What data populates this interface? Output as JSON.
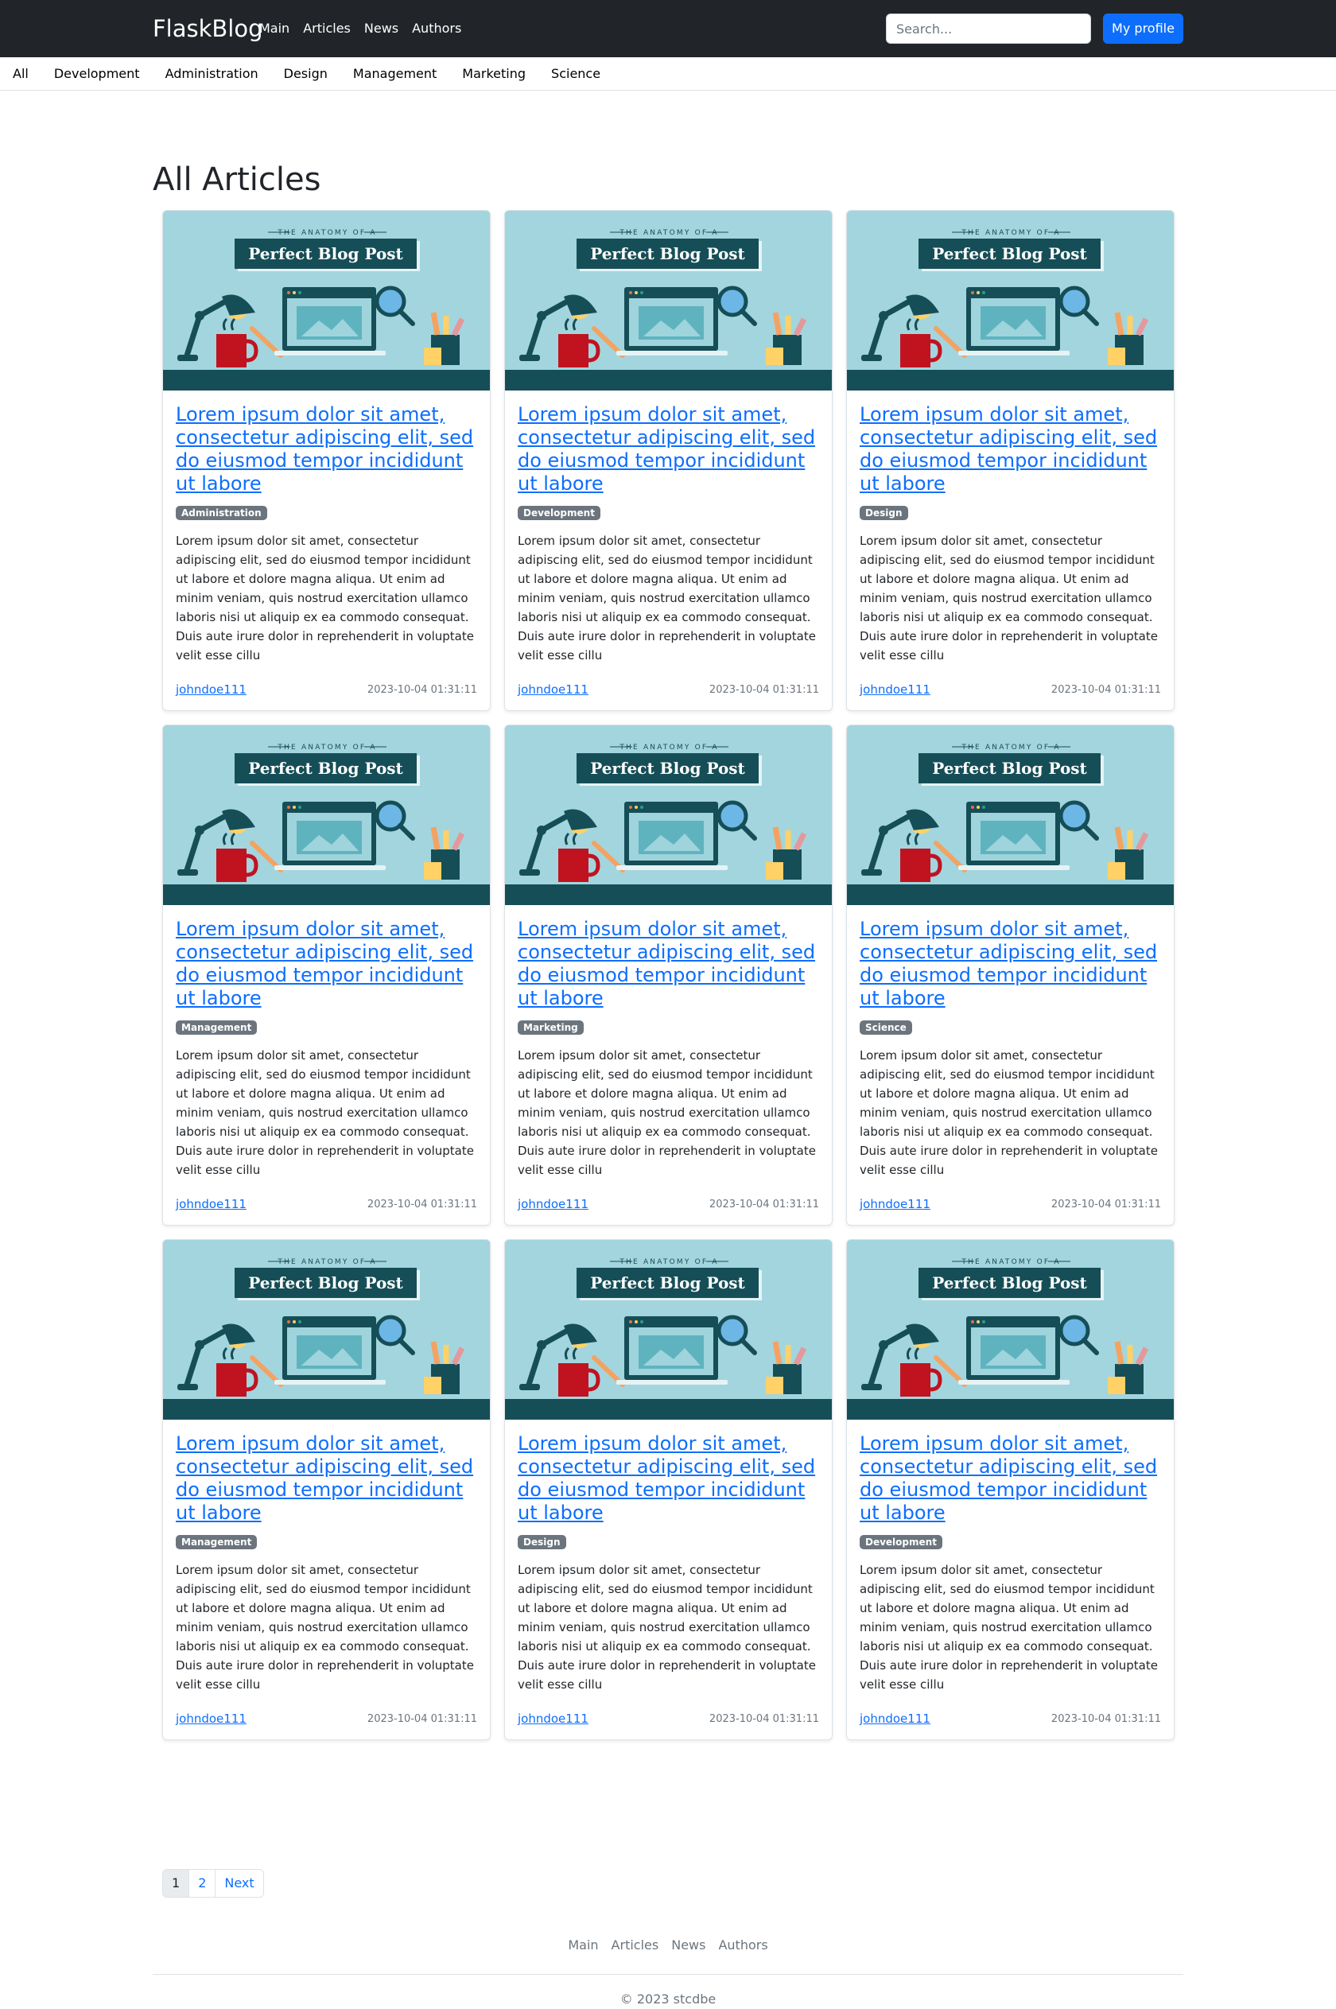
{
  "navbar": {
    "brand": "FlaskBlog",
    "links": [
      "Main",
      "Articles",
      "News",
      "Authors"
    ],
    "search_placeholder": "Search...",
    "profile_button": "My profile"
  },
  "categories": [
    "All",
    "Development",
    "Administration",
    "Design",
    "Management",
    "Marketing",
    "Science"
  ],
  "page_title": "All Articles",
  "image_text": {
    "top": "THE ANATOMY OF A",
    "banner": "Perfect Blog Post"
  },
  "colors": {
    "navbar_bg": "#212529",
    "accent": "#0d6efd",
    "badge": "#6c757d",
    "image_bg": "#a3d5de",
    "image_dark": "#164e57"
  },
  "articles": [
    {
      "title": "Lorem ipsum dolor sit amet, consectetur adipiscing elit, sed do eiusmod tempor incididunt ut labore",
      "category": "Administration",
      "text": "Lorem ipsum dolor sit amet, consectetur adipiscing elit, sed do eiusmod tempor incididunt ut labore et dolore magna aliqua. Ut enim ad minim veniam, quis nostrud exercitation ullamco laboris nisi ut aliquip ex ea commodo consequat. Duis aute irure dolor in reprehenderit in voluptate velit esse cillu",
      "author": "johndoe111",
      "date": "2023-10-04 01:31:11"
    },
    {
      "title": "Lorem ipsum dolor sit amet, consectetur adipiscing elit, sed do eiusmod tempor incididunt ut labore",
      "category": "Development",
      "text": "Lorem ipsum dolor sit amet, consectetur adipiscing elit, sed do eiusmod tempor incididunt ut labore et dolore magna aliqua. Ut enim ad minim veniam, quis nostrud exercitation ullamco laboris nisi ut aliquip ex ea commodo consequat. Duis aute irure dolor in reprehenderit in voluptate velit esse cillu",
      "author": "johndoe111",
      "date": "2023-10-04 01:31:11"
    },
    {
      "title": "Lorem ipsum dolor sit amet, consectetur adipiscing elit, sed do eiusmod tempor incididunt ut labore",
      "category": "Design",
      "text": "Lorem ipsum dolor sit amet, consectetur adipiscing elit, sed do eiusmod tempor incididunt ut labore et dolore magna aliqua. Ut enim ad minim veniam, quis nostrud exercitation ullamco laboris nisi ut aliquip ex ea commodo consequat. Duis aute irure dolor in reprehenderit in voluptate velit esse cillu",
      "author": "johndoe111",
      "date": "2023-10-04 01:31:11"
    },
    {
      "title": "Lorem ipsum dolor sit amet, consectetur adipiscing elit, sed do eiusmod tempor incididunt ut labore",
      "category": "Management",
      "text": "Lorem ipsum dolor sit amet, consectetur adipiscing elit, sed do eiusmod tempor incididunt ut labore et dolore magna aliqua. Ut enim ad minim veniam, quis nostrud exercitation ullamco laboris nisi ut aliquip ex ea commodo consequat. Duis aute irure dolor in reprehenderit in voluptate velit esse cillu",
      "author": "johndoe111",
      "date": "2023-10-04 01:31:11"
    },
    {
      "title": "Lorem ipsum dolor sit amet, consectetur adipiscing elit, sed do eiusmod tempor incididunt ut labore",
      "category": "Marketing",
      "text": "Lorem ipsum dolor sit amet, consectetur adipiscing elit, sed do eiusmod tempor incididunt ut labore et dolore magna aliqua. Ut enim ad minim veniam, quis nostrud exercitation ullamco laboris nisi ut aliquip ex ea commodo consequat. Duis aute irure dolor in reprehenderit in voluptate velit esse cillu",
      "author": "johndoe111",
      "date": "2023-10-04 01:31:11"
    },
    {
      "title": "Lorem ipsum dolor sit amet, consectetur adipiscing elit, sed do eiusmod tempor incididunt ut labore",
      "category": "Science",
      "text": "Lorem ipsum dolor sit amet, consectetur adipiscing elit, sed do eiusmod tempor incididunt ut labore et dolore magna aliqua. Ut enim ad minim veniam, quis nostrud exercitation ullamco laboris nisi ut aliquip ex ea commodo consequat. Duis aute irure dolor in reprehenderit in voluptate velit esse cillu",
      "author": "johndoe111",
      "date": "2023-10-04 01:31:11"
    },
    {
      "title": "Lorem ipsum dolor sit amet, consectetur adipiscing elit, sed do eiusmod tempor incididunt ut labore",
      "category": "Management",
      "text": "Lorem ipsum dolor sit amet, consectetur adipiscing elit, sed do eiusmod tempor incididunt ut labore et dolore magna aliqua. Ut enim ad minim veniam, quis nostrud exercitation ullamco laboris nisi ut aliquip ex ea commodo consequat. Duis aute irure dolor in reprehenderit in voluptate velit esse cillu",
      "author": "johndoe111",
      "date": "2023-10-04 01:31:11"
    },
    {
      "title": "Lorem ipsum dolor sit amet, consectetur adipiscing elit, sed do eiusmod tempor incididunt ut labore",
      "category": "Design",
      "text": "Lorem ipsum dolor sit amet, consectetur adipiscing elit, sed do eiusmod tempor incididunt ut labore et dolore magna aliqua. Ut enim ad minim veniam, quis nostrud exercitation ullamco laboris nisi ut aliquip ex ea commodo consequat. Duis aute irure dolor in reprehenderit in voluptate velit esse cillu",
      "author": "johndoe111",
      "date": "2023-10-04 01:31:11"
    },
    {
      "title": "Lorem ipsum dolor sit amet, consectetur adipiscing elit, sed do eiusmod tempor incididunt ut labore",
      "category": "Development",
      "text": "Lorem ipsum dolor sit amet, consectetur adipiscing elit, sed do eiusmod tempor incididunt ut labore et dolore magna aliqua. Ut enim ad minim veniam, quis nostrud exercitation ullamco laboris nisi ut aliquip ex ea commodo consequat. Duis aute irure dolor in reprehenderit in voluptate velit esse cillu",
      "author": "johndoe111",
      "date": "2023-10-04 01:31:11"
    }
  ],
  "pagination": {
    "pages": [
      "1",
      "2"
    ],
    "next": "Next",
    "current": "1"
  },
  "footer": {
    "links": [
      "Main",
      "Articles",
      "News",
      "Authors"
    ],
    "copyright": "© 2023 stcdbe"
  }
}
